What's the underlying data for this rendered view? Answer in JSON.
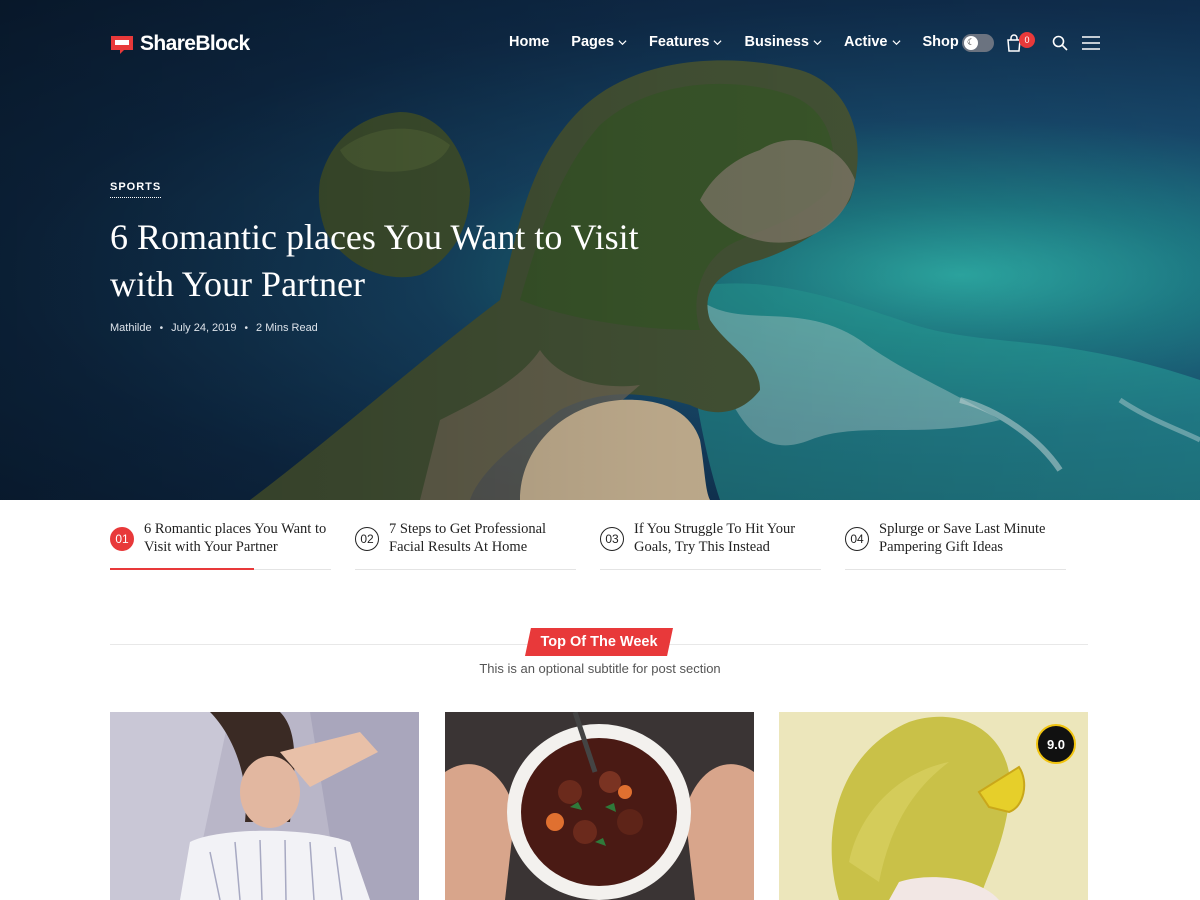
{
  "brand": {
    "name": "ShareBlock",
    "accent": "#e8393a"
  },
  "nav": {
    "items": [
      {
        "label": "Home",
        "dropdown": false
      },
      {
        "label": "Pages",
        "dropdown": true
      },
      {
        "label": "Features",
        "dropdown": true
      },
      {
        "label": "Business",
        "dropdown": true
      },
      {
        "label": "Active",
        "dropdown": true
      },
      {
        "label": "Shop",
        "dropdown": true
      }
    ],
    "cart_count": "0",
    "icons": [
      "dark-mode-toggle",
      "cart-icon",
      "search-icon",
      "menu-icon"
    ]
  },
  "hero": {
    "category": "SPORTS",
    "title": "6 Romantic places You Want to Visit with Your Partner",
    "author": "Mathilde",
    "date": "July 24, 2019",
    "read_time": "2 Mins Read"
  },
  "ticker": [
    {
      "num": "01",
      "title": "6 Romantic places You Want to Visit with Your Partner",
      "active": true,
      "progress": 0.65
    },
    {
      "num": "02",
      "title": "7 Steps to Get Professional Facial Results At Home",
      "active": false
    },
    {
      "num": "03",
      "title": "If You Struggle To Hit Your Goals, Try This Instead",
      "active": false
    },
    {
      "num": "04",
      "title": "Splurge or Save Last Minute Pampering Gift Ideas",
      "active": false
    }
  ],
  "section": {
    "title": "Top Of The Week",
    "subtitle": "This is an optional subtitle for post section"
  },
  "cards": [
    {
      "image": "woman-lying-shading-face",
      "score": null
    },
    {
      "image": "bowl-of-stew",
      "score": null
    },
    {
      "image": "woman-yellow-sunglasses",
      "score": "9.0"
    }
  ]
}
